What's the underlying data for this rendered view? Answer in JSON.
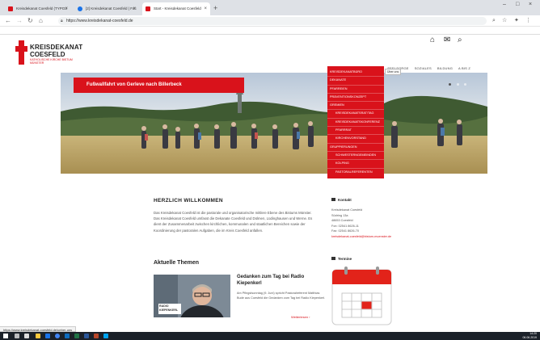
{
  "browser": {
    "tabs": [
      {
        "label": "Kreisdekanat Coesfeld (TYPO3",
        "icon": "red"
      },
      {
        "label": "[2] Kreisdekanat Coesfeld | Fac",
        "icon": "blue"
      },
      {
        "label": "Start - Kreisdekanat Coesfeld",
        "icon": "red"
      }
    ],
    "new_tab": "+",
    "url": "https://www.kreisdekanat-coesfeld.de",
    "bookmarks": [
      {
        "label": "(9) Facebook",
        "c": "b"
      },
      {
        "label": "Jodus",
        "c": ""
      },
      {
        "label": "Bistum MS",
        "c": ""
      },
      {
        "label": "KD Coesfeld",
        "c": ""
      },
      {
        "label": "BAU COE",
        "c": ""
      },
      {
        "label": "Medienbibliothek",
        "c": ""
      },
      {
        "label": "Typo 3 Login",
        "c": ""
      },
      {
        "label": "glosbalier.de",
        "c": "g"
      },
      {
        "label": "Kurze Links",
        "c": "k"
      },
      {
        "label": "Briefmarken",
        "c": "y"
      },
      {
        "label": "E-Paper",
        "c": "k"
      },
      {
        "label": "Google",
        "c": "b"
      },
      {
        "label": "Google Maps",
        "c": "g"
      },
      {
        "label": "SPORT Shop",
        "c": "b"
      },
      {
        "label": "Meine Bilder",
        "c": "g"
      },
      {
        "label": "Eigene Umfragen er...",
        "c": "b"
      },
      {
        "label": "Weitere Favoriten",
        "c": "y"
      }
    ],
    "status_url": "https://www.kreisdekanat-coesfeld.de/ueber-uns"
  },
  "site": {
    "logo": {
      "line1": "KREISDEKANAT",
      "line2": "COESFELD",
      "line3": "KATHOLISCHE KIRCHE BISTUM MÜNSTER"
    },
    "nav": [
      "AKTUELLES",
      "ÜBER UNS",
      "SEELSORGE",
      "SOZIALES",
      "BILDUNG",
      "A BIS Z"
    ],
    "nav_active": 1,
    "dropdown": [
      {
        "label": "KREISDEKANATBÜRO",
        "sub": false
      },
      {
        "label": "DEKANATE",
        "sub": false
      },
      {
        "label": "PFARREIEN",
        "sub": false
      },
      {
        "label": "PRÄVENTIONSKONZEPT",
        "sub": false
      },
      {
        "label": "GREMIEN",
        "sub": false
      },
      {
        "label": "KREISDEKANATSRAT/TAG",
        "sub": true
      },
      {
        "label": "KREISDEKANATSKONFERENZ",
        "sub": true
      },
      {
        "label": "PFARRRAT",
        "sub": true
      },
      {
        "label": "KIRCHENVORSTAND",
        "sub": true
      },
      {
        "label": "GRUPPIERUNGEN",
        "sub": false
      },
      {
        "label": "SCHWESTERNGEMEINDEN",
        "sub": true
      },
      {
        "label": "KOLPING",
        "sub": true
      },
      {
        "label": "PASTORALREFERENTEN",
        "sub": true
      }
    ],
    "tooltip": "Über uns",
    "hero_title": "Fußwallfahrt von Gerleve nach Billerbeck",
    "welcome_heading": "HERZLICH WILLKOMMEN",
    "welcome_text": "Das Kreisdekanat Coesfeld ist die pastorale und organisatorische mittlere Ebene des Bistums Münster. Das Kreisdekanat Coesfeld umfasst die Dekanate Coesfeld und Dülmen, Lüdinghausen und Werne. Es dient der Zusammenarbeit zwischen kirchlichen, kommunalen und staatlichen Bereichen sowie der Koordinierung der pastoralen Aufgaben, die im Kreis Coesfeld anfallen.",
    "topics_heading": "Aktuelle Themen",
    "article_title": "Gedanken zum Tag bei Radio Kiepenkerl",
    "article_text": "Am Pfingstsonntag (9. Juni) spricht Pastoralreferent Matthias Bude aus Coesfeld die Gedanken zum Tag bei Radio Kiepenkerl.",
    "article_more": "Weiterlesen",
    "thumb_caption": "RADIO KIEPENKERL",
    "contact_heading": "Kontakt",
    "contact_lines": [
      "Kreisdekanat Coesfeld",
      "Südring 13a",
      "48653 Coesfeld",
      "Fon: 02541 8626-11",
      "Fax: 02541 8626-70"
    ],
    "contact_mail": "kreisdekanat-coesfeld@bistum-muenster.de",
    "dates_heading": "Termine"
  },
  "taskbar": {
    "time": "14:20",
    "date": "06.06.2019"
  }
}
